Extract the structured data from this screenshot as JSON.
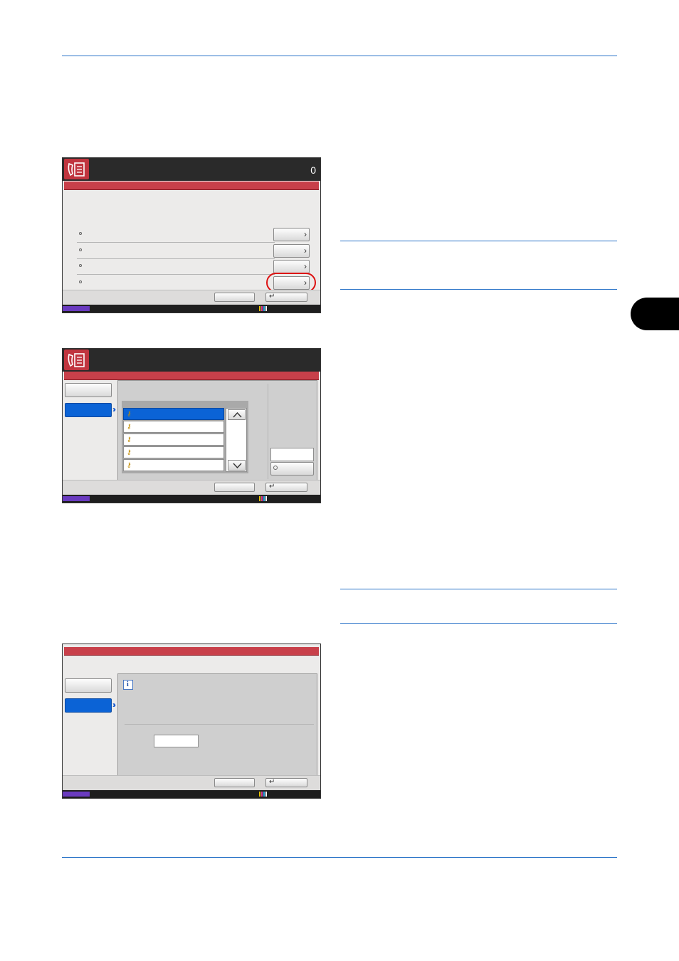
{
  "screen1": {
    "counter": "0",
    "rows": [
      {
        "arrow": "›"
      },
      {
        "arrow": "›"
      },
      {
        "arrow": "›"
      },
      {
        "arrow": "›"
      }
    ]
  },
  "screen2": {
    "list_items": 5
  },
  "colors": {
    "page_rule": "#2a73c8",
    "title_bar": "#c8404a",
    "selected": "#0b63d6",
    "status_accent": "#6a3bbf",
    "highlight_ring": "#dd1111"
  }
}
